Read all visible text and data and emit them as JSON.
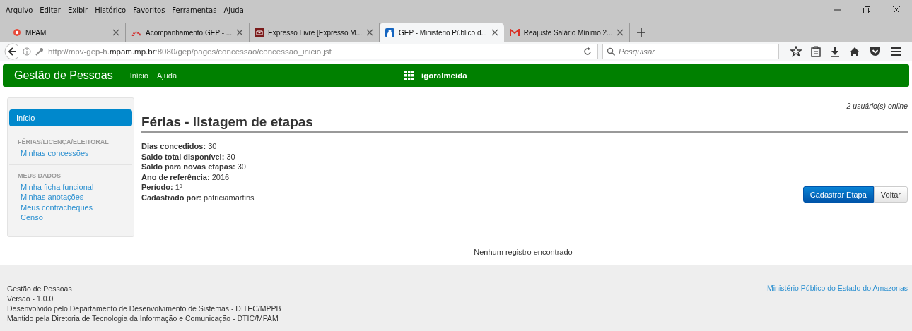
{
  "menu_bar": [
    "Arquivo",
    "Editar",
    "Exibir",
    "Histórico",
    "Favoritos",
    "Ferramentas",
    "Ajuda"
  ],
  "tabs": [
    {
      "title": "MPAM",
      "selected": false,
      "kind": "ring"
    },
    {
      "title": "Acompanhamento GEP - ...",
      "selected": false,
      "kind": "arc"
    },
    {
      "title": "Expresso Livre [Expresso M...",
      "selected": false,
      "kind": "mail"
    },
    {
      "title": "GEP - Ministério Público d...",
      "selected": true,
      "kind": "person"
    },
    {
      "title": "Reajuste Salário Mínimo 2...",
      "selected": false,
      "kind": "gmail"
    }
  ],
  "address_bar": {
    "url": "http://mpv-gep-h.**mpam.mp.br**:8080/gep/pages/concessao/concessao_inicio.jsf"
  },
  "search": {
    "placeholder": "Pesquisar"
  },
  "app_bar": {
    "brand": "Gestão de Pessoas",
    "links": [
      "Início",
      "Ajuda"
    ],
    "user": "igoralmeida"
  },
  "sidebar": {
    "items": [
      {
        "label": "Início",
        "selected": true
      }
    ],
    "sections": [
      {
        "title": "FÉRIAS/LICENÇA/ELEITORAL",
        "links": [
          "Minhas concessões"
        ]
      },
      {
        "title": "MEUS DADOS",
        "links": [
          "Minha ficha funcional",
          "Minhas anotações",
          "Meus contracheques",
          "Censo"
        ]
      }
    ]
  },
  "online": "2 usuário(s) online",
  "page_title": "Férias - listagem de etapas",
  "fields": [
    {
      "label": "Dias concedidos:",
      "value": "30"
    },
    {
      "label": "Saldo total disponível:",
      "value": "30"
    },
    {
      "label": "Saldo para novas etapas:",
      "value": "30"
    },
    {
      "label": "Ano de referência:",
      "value": "2016"
    },
    {
      "label": "Período:",
      "value": "1º"
    },
    {
      "label": "Cadastrado por:",
      "value": "patriciamartins"
    }
  ],
  "buttons": [
    {
      "label": "Cadastrar Etapa",
      "kind": "primary"
    },
    {
      "label": "Voltar",
      "kind": "default"
    }
  ],
  "empty_message": "Nenhum registro encontrado",
  "footer": {
    "lines": [
      "Gestão de Pessoas",
      "Versão - 1.0.0",
      "Desenvolvido pelo Departamento de Desenvolvimento de Sistemas - DITEC/MPPB",
      "Mantido pela Diretoria de Tecnologia da Informação e Comunicação - DTIC/MPAM"
    ],
    "link": "Ministério Público do Estado do Amazonas"
  }
}
